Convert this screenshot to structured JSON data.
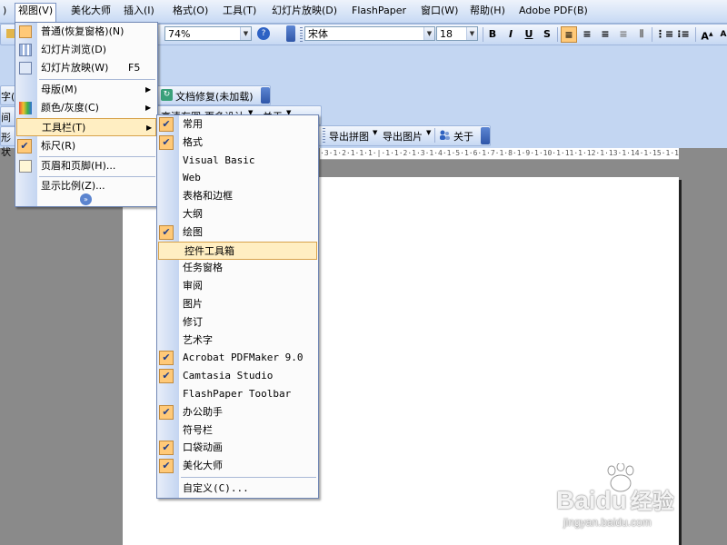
{
  "menubar": {
    "items": [
      {
        "label": ")"
      },
      {
        "label": "视图(V)"
      },
      {
        "label": "美化大师"
      },
      {
        "label": "插入(I)"
      },
      {
        "label": "格式(O)"
      },
      {
        "label": "工具(T)"
      },
      {
        "label": "幻灯片放映(D)"
      },
      {
        "label": "FlashPaper"
      },
      {
        "label": "窗口(W)"
      },
      {
        "label": "帮助(H)"
      },
      {
        "label": "Adobe PDF(B)"
      }
    ]
  },
  "formatting_toolbar": {
    "zoom_value": "74%",
    "font_value": "宋体",
    "size_value": "18",
    "bold": "B",
    "italic": "I",
    "underline": "U",
    "shadow": "S",
    "font_grow": "A"
  },
  "toolbar2": {
    "doc_repair": "文档修复(未加载)"
  },
  "toolbar3": {
    "hd_image": "高清存图",
    "more_design": "更多设计",
    "about_menu": "关于"
  },
  "toolbar4": {
    "export_collage": "导出拼图",
    "export_image": "导出图片",
    "about": "关于"
  },
  "left_stubs": [
    "字(",
    "间序",
    "形状"
  ],
  "ruler_text": "·3·1·2·1·1·1·|·1·1·2·1·3·1·4·1·5·1·6·1·7·1·8·1·9·1·10·1·11·1·12·1·13·1·14·1·15·1·16·1·17·1·18·1·19·1·20·1·21·1·22·1·23·1·24·1·25·1·26·1·27·1·28·1·29·1·30·1·31·1·32·1·33·1·34·1·35·1·36·1·37·1·38·1·39·1·40·1·41·1·42·1·",
  "view_menu": {
    "items": [
      {
        "label": "普通(恢复窗格)(N)",
        "shortcut": ""
      },
      {
        "label": "幻灯片浏览(D)",
        "shortcut": ""
      },
      {
        "label": "幻灯片放映(W)",
        "shortcut": "F5"
      },
      {
        "label": "母版(M)",
        "shortcut": ""
      },
      {
        "label": "颜色/灰度(C)",
        "shortcut": ""
      },
      {
        "label": "工具栏(T)",
        "shortcut": ""
      },
      {
        "label": "标尺(R)",
        "shortcut": ""
      },
      {
        "label": "页眉和页脚(H)...",
        "shortcut": ""
      },
      {
        "label": "显示比例(Z)...",
        "shortcut": ""
      }
    ],
    "expand_icon": "double-chevron-down-icon"
  },
  "toolbars_submenu": {
    "items": [
      {
        "label": "常用",
        "checked": true
      },
      {
        "label": "格式",
        "checked": true
      },
      {
        "label": "Visual Basic",
        "checked": false
      },
      {
        "label": "Web",
        "checked": false
      },
      {
        "label": "表格和边框",
        "checked": false
      },
      {
        "label": "大纲",
        "checked": false
      },
      {
        "label": "绘图",
        "checked": true
      },
      {
        "label": "控件工具箱",
        "checked": false
      },
      {
        "label": "任务窗格",
        "checked": false
      },
      {
        "label": "审阅",
        "checked": false
      },
      {
        "label": "图片",
        "checked": false
      },
      {
        "label": "修订",
        "checked": false
      },
      {
        "label": "艺术字",
        "checked": false
      },
      {
        "label": "Acrobat PDFMaker 9.0",
        "checked": true
      },
      {
        "label": "Camtasia Studio",
        "checked": true
      },
      {
        "label": "FlashPaper Toolbar",
        "checked": false
      },
      {
        "label": "办公助手",
        "checked": true
      },
      {
        "label": "符号栏",
        "checked": false
      },
      {
        "label": "口袋动画",
        "checked": true
      },
      {
        "label": "美化大师",
        "checked": true
      },
      {
        "label": "自定义(C)...",
        "checked": false
      }
    ]
  },
  "watermark": {
    "brand": "Baidu",
    "brand_cn": "经验",
    "url": "jingyan.baidu.com"
  },
  "colors": {
    "menu_highlight": "#ffeec2",
    "check_bg": "#ffc978",
    "toolbar_blue": "#c6d8f3",
    "workspace": "#8a8a8a"
  }
}
